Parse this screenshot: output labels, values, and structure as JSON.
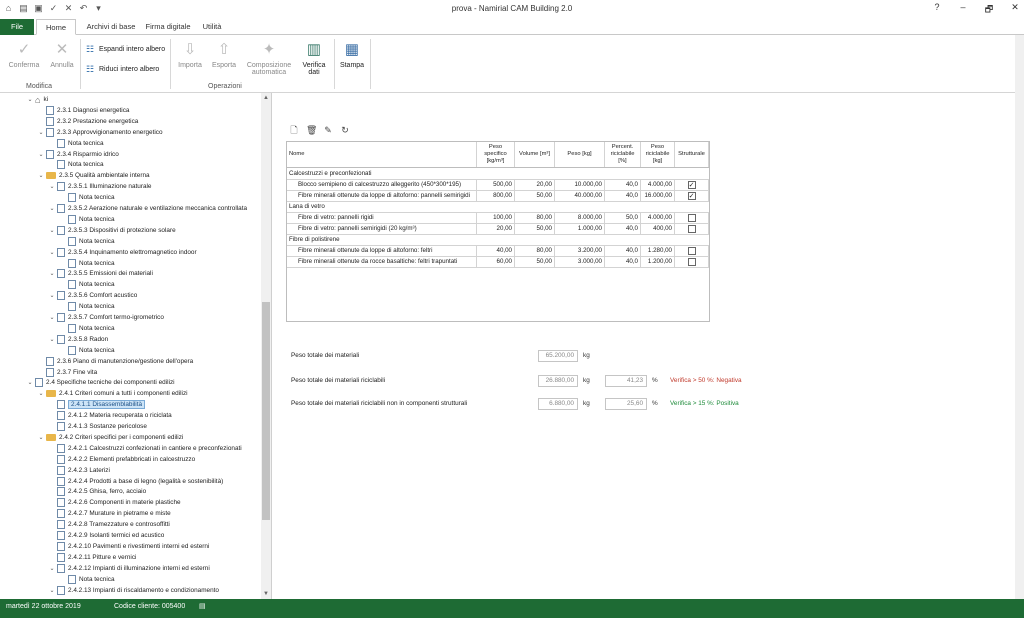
{
  "app": {
    "title": "prova - Namirial CAM Building 2.0"
  },
  "window": {
    "help": "?",
    "minimize": "–",
    "restore": "🗗",
    "close": "✕"
  },
  "tabs": [
    {
      "label": "File"
    },
    {
      "label": "Home"
    },
    {
      "label": "Archivi di base"
    },
    {
      "label": "Firma digitale"
    },
    {
      "label": "Utilità"
    }
  ],
  "ribbon": {
    "conferma": "Conferma",
    "annulla": "Annulla",
    "group_modifica": "Modifica",
    "espandi": "Espandi intero albero",
    "riduci": "Riduci intero albero",
    "importa": "Importa",
    "esporta": "Esporta",
    "composizione_1": "Composizione",
    "composizione_2": "automatica",
    "verifica_1": "Verifica",
    "verifica_2": "dati",
    "stampa": "Stampa",
    "group_operazioni": "Operazioni"
  },
  "tree": [
    {
      "label": "ki",
      "indent": 0,
      "type": "home",
      "chev": "v"
    },
    {
      "label": "2.3.1 Diagnosi energetica",
      "indent": 1,
      "type": "doc",
      "chev": ""
    },
    {
      "label": "2.3.2 Prestazione energetica",
      "indent": 1,
      "type": "doc",
      "chev": ""
    },
    {
      "label": "2.3.3 Approvvigionamento energetico",
      "indent": 1,
      "type": "doc",
      "chev": "v"
    },
    {
      "label": "Nota tecnica",
      "indent": 2,
      "type": "doc",
      "chev": ""
    },
    {
      "label": "2.3.4 Risparmio idrico",
      "indent": 1,
      "type": "doc",
      "chev": "v"
    },
    {
      "label": "Nota tecnica",
      "indent": 2,
      "type": "doc",
      "chev": ""
    },
    {
      "label": "2.3.5 Qualità ambientale interna",
      "indent": 1,
      "type": "folder",
      "chev": "v"
    },
    {
      "label": "2.3.5.1 Illuminazione naturale",
      "indent": 2,
      "type": "doc",
      "chev": "v"
    },
    {
      "label": "Nota tecnica",
      "indent": 3,
      "type": "doc",
      "chev": ""
    },
    {
      "label": "2.3.5.2 Aerazione naturale e ventilazione meccanica controllata",
      "indent": 2,
      "type": "doc",
      "chev": "v"
    },
    {
      "label": "Nota tecnica",
      "indent": 3,
      "type": "doc",
      "chev": ""
    },
    {
      "label": "2.3.5.3 Dispositivi di protezione solare",
      "indent": 2,
      "type": "doc",
      "chev": "v"
    },
    {
      "label": "Nota tecnica",
      "indent": 3,
      "type": "doc",
      "chev": ""
    },
    {
      "label": "2.3.5.4 Inquinamento elettromagnetico indoor",
      "indent": 2,
      "type": "doc",
      "chev": "v"
    },
    {
      "label": "Nota tecnica",
      "indent": 3,
      "type": "doc",
      "chev": ""
    },
    {
      "label": "2.3.5.5 Emissioni dei materiali",
      "indent": 2,
      "type": "doc",
      "chev": "v"
    },
    {
      "label": "Nota tecnica",
      "indent": 3,
      "type": "doc",
      "chev": ""
    },
    {
      "label": "2.3.5.6 Comfort acustico",
      "indent": 2,
      "type": "doc",
      "chev": "v"
    },
    {
      "label": "Nota tecnica",
      "indent": 3,
      "type": "doc",
      "chev": ""
    },
    {
      "label": "2.3.5.7 Comfort termo-igrometrico",
      "indent": 2,
      "type": "doc",
      "chev": "v"
    },
    {
      "label": "Nota tecnica",
      "indent": 3,
      "type": "doc",
      "chev": ""
    },
    {
      "label": "2.3.5.8 Radon",
      "indent": 2,
      "type": "doc",
      "chev": "v"
    },
    {
      "label": "Nota tecnica",
      "indent": 3,
      "type": "doc",
      "chev": ""
    },
    {
      "label": "2.3.6 Piano di manutenzione/gestione dell'opera",
      "indent": 1,
      "type": "doc",
      "chev": ""
    },
    {
      "label": "2.3.7 Fine vita",
      "indent": 1,
      "type": "doc",
      "chev": ""
    },
    {
      "label": "2.4 Specifiche tecniche dei componenti edilizi",
      "indent": 0,
      "type": "doc",
      "chev": "v"
    },
    {
      "label": "2.4.1 Criteri comuni a tutti i componenti edilizi",
      "indent": 1,
      "type": "folder",
      "chev": "v"
    },
    {
      "label": "2.4.1.1 Disassemblabilità",
      "indent": 2,
      "type": "doc",
      "chev": "",
      "selected": true
    },
    {
      "label": "2.4.1.2 Materia recuperata o riciclata",
      "indent": 2,
      "type": "doc",
      "chev": ""
    },
    {
      "label": "2.4.1.3 Sostanze pericolose",
      "indent": 2,
      "type": "doc",
      "chev": ""
    },
    {
      "label": "2.4.2 Criteri specifici per i componenti edilizi",
      "indent": 1,
      "type": "folder",
      "chev": "v"
    },
    {
      "label": "2.4.2.1 Calcestruzzi confezionati in cantiere e preconfezionati",
      "indent": 2,
      "type": "doc",
      "chev": ""
    },
    {
      "label": "2.4.2.2 Elementi prefabbricati in calcestruzzo",
      "indent": 2,
      "type": "doc",
      "chev": ""
    },
    {
      "label": "2.4.2.3 Laterizi",
      "indent": 2,
      "type": "doc",
      "chev": ""
    },
    {
      "label": "2.4.2.4 Prodotti a base di legno (legalità e sostenibilità)",
      "indent": 2,
      "type": "doc",
      "chev": ""
    },
    {
      "label": "2.4.2.5 Ghisa, ferro, acciaio",
      "indent": 2,
      "type": "doc",
      "chev": ""
    },
    {
      "label": "2.4.2.6 Componenti in materie plastiche",
      "indent": 2,
      "type": "doc",
      "chev": ""
    },
    {
      "label": "2.4.2.7 Murature in pietrame e miste",
      "indent": 2,
      "type": "doc",
      "chev": ""
    },
    {
      "label": "2.4.2.8 Tramezzature e controsoffitti",
      "indent": 2,
      "type": "doc",
      "chev": ""
    },
    {
      "label": "2.4.2.9 Isolanti termici ed acustico",
      "indent": 2,
      "type": "doc",
      "chev": ""
    },
    {
      "label": "2.4.2.10 Pavimenti e rivestimenti interni ed esterni",
      "indent": 2,
      "type": "doc",
      "chev": ""
    },
    {
      "label": "2.4.2.11 Pitture e vernici",
      "indent": 2,
      "type": "doc",
      "chev": ""
    },
    {
      "label": "2.4.2.12 Impianti di illuminazione interni ed esterni",
      "indent": 2,
      "type": "doc",
      "chev": "v"
    },
    {
      "label": "Nota tecnica",
      "indent": 3,
      "type": "doc",
      "chev": ""
    },
    {
      "label": "2.4.2.13 Impianti di riscaldamento e condizionamento",
      "indent": 2,
      "type": "doc",
      "chev": "v"
    }
  ],
  "table": {
    "headers": [
      "Nome",
      "Peso specifico [kg/m³]",
      "Volume [m³]",
      "Peso [kg]",
      "Percent. riciclabile [%]",
      "Peso riciclabile [kg]",
      "Strutturale"
    ],
    "rows": [
      {
        "group": "Calcestruzzi e preconfezionati"
      },
      {
        "cells": [
          "Blocco semipieno di calcestruzzo alleggerito (450*300*195)",
          "500,00",
          "20,00",
          "10.000,00",
          "40,0",
          "4.000,00"
        ],
        "checked": true
      },
      {
        "cells": [
          "Fibre minerali ottenute da loppe di altoforno: pannelli semirigidi",
          "800,00",
          "50,00",
          "40.000,00",
          "40,0",
          "16.000,00"
        ],
        "checked": true
      },
      {
        "group": "Lana di vetro"
      },
      {
        "cells": [
          "Fibre di vetro: pannelli rigidi",
          "100,00",
          "80,00",
          "8.000,00",
          "50,0",
          "4.000,00"
        ],
        "checked": false
      },
      {
        "cells": [
          "Fibre di vetro: pannelli semirigidi (20 kg/m³)",
          "20,00",
          "50,00",
          "1.000,00",
          "40,0",
          "400,00"
        ],
        "checked": false
      },
      {
        "group": "Fibre di polistirene"
      },
      {
        "cells": [
          "Fibre minerali ottenute da loppe di altoforno: feltri",
          "40,00",
          "80,00",
          "3.200,00",
          "40,0",
          "1.280,00"
        ],
        "checked": false
      },
      {
        "cells": [
          "Fibre minerali ottenute da rocce basaltiche: feltri trapuntati",
          "60,00",
          "50,00",
          "3.000,00",
          "40,0",
          "1.200,00"
        ],
        "checked": false
      }
    ]
  },
  "totals": {
    "peso_totale_label": "Peso totale dei materiali",
    "peso_totale_value": "65.200,00",
    "riciclabili_label": "Peso totale dei materiali riciclabili",
    "riciclabili_value": "26.880,00",
    "riciclabili_pct": "41,23",
    "riciclabili_check": "Verifica > 50 %: Negativa",
    "non_strutturali_label": "Peso totale dei materiali riciclabili non in componenti strutturali",
    "non_strutturali_value": "6.880,00",
    "non_strutturali_pct": "25,60",
    "non_strutturali_check": "Verifica > 15 %: Positiva",
    "unit_kg": "kg",
    "unit_pct": "%"
  },
  "status": {
    "date": "martedì 22 ottobre 2019",
    "client_code": "Codice cliente: 005400"
  }
}
